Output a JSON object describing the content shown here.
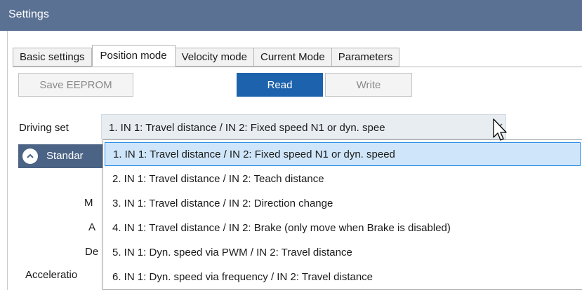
{
  "window": {
    "title": "Settings"
  },
  "tabs": [
    "Basic settings",
    "Position mode",
    "Velocity mode",
    "Current Mode",
    "Parameters"
  ],
  "active_tab": "Position mode",
  "toolbar": {
    "save_label": "Save EEPROM",
    "read_label": "Read",
    "write_label": "Write"
  },
  "driving_set": {
    "label": "Driving set",
    "value": "1. IN 1: Travel distance / IN 2: Fixed speed N1 or dyn. spee",
    "options": [
      "1. IN 1: Travel distance / IN 2: Fixed speed N1 or dyn. speed",
      "2. IN 1: Travel distance / IN 2: Teach distance",
      "3. IN 1: Travel distance / IN 2: Direction change",
      "4. IN 1: Travel distance / IN 2: Brake (only move when Brake is disabled)",
      "5. IN 1: Dyn. speed via PWM / IN 2: Travel distance",
      "6. IN 1: Dyn. speed via frequency / IN 2: Travel distance"
    ],
    "selected_index": 0
  },
  "group": {
    "label": "Standar"
  },
  "side_labels": [
    "M",
    "A",
    "De",
    "Acceleratio"
  ],
  "colors": {
    "title_bar": "#5a7193",
    "read_button": "#1c62ad",
    "group_bar": "#4b6385",
    "selected_option": "#cfe6fa"
  }
}
